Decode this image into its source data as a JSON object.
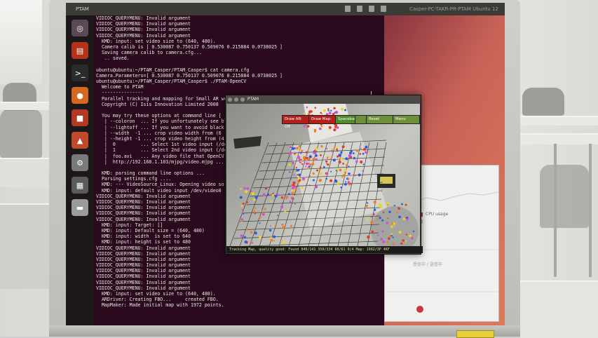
{
  "window_title": "PTAM",
  "topbar": {
    "title": "PTAM",
    "clock": "Casper-PC-TAKR-PR-PTAM Ubuntu 12"
  },
  "launcher": [
    {
      "name": "ubuntu-logo-icon",
      "glyph": "◎",
      "color": "#5a4a56"
    },
    {
      "name": "files-icon",
      "glyph": "▤",
      "color": "#b2321c"
    },
    {
      "name": "terminal-icon",
      "glyph": ">_",
      "color": "#2b2b2b"
    },
    {
      "name": "firefox-icon",
      "glyph": "●",
      "color": "#d2691e"
    },
    {
      "name": "office-icon",
      "glyph": "■",
      "color": "#b23a25"
    },
    {
      "name": "software-center-icon",
      "glyph": "▲",
      "color": "#c04a2c"
    },
    {
      "name": "settings-icon",
      "glyph": "⚙",
      "color": "#7a7a7a"
    },
    {
      "name": "workspace-icon",
      "glyph": "▦",
      "color": "#5b5b5b"
    },
    {
      "name": "trash-icon",
      "glyph": "▬",
      "color": "#9a9a9a"
    }
  ],
  "terminal": {
    "lines": [
      "VIDIOC_QUERYMENU: Invalid argument",
      "VIDIOC_QUERYMENU: Invalid argument",
      "VIDIOC_QUERYMENU: Invalid argument",
      "VIDIOC_QUERYMENU: Invalid argument",
      "  KMD: input: set video size to (640, 480).",
      "  Camera calib is [ 0.530087 0.750137 0.509076 0.215884 0.0738025 ]",
      "  Saving camera calib to camera.cfg...",
      "   .. saved.",
      "",
      "ubuntu@ubuntu:~/PTAM_Casper/PTAM_Casper$ cat camera.cfg",
      "Camera.Parameters=[ 0.530087 0.750137 0.509076 0.215884 0.0738025 ]",
      "ubuntu@ubuntu:~/PTAM_Casper/PTAM_Casper$ ./PTAM-OpenCV",
      "  Welcome to PTAM",
      "  ---------------",
      "  Parallel tracking and mapping for Small AR wo",
      "  Copyright (C) Isis Innovation Limited 2008",
      "",
      "  You may try these options at command line [",
      "   | --coloron  ... If you unfortunately see bl",
      "   | --lightoff ... If you want to avoid black",
      "   | --width  -1 ... crop video width from (6",
      "   | --height -1 ... crop video height from (4",
      "   |  0         ... Select 1st video input (/de",
      "   |  1         ... Select 2nd video input (/de",
      "   |  foo.avi   ... Any video file that OpenCV",
      "   |  http://192.168.1.103/mjpg/video.mjpg ...",
      "",
      "  KMD: parsing command line options ...",
      "  Parsing settings.cfg ....",
      "  KMD: --- VideoSource_Linux: Opening video so",
      "  KMD: input: default video input /dev/video0",
      "VIDIOC_QUERYMENU: Invalid argument",
      "VIDIOC_QUERYMENU: Invalid argument",
      "VIDIOC_QUERYMENU: Invalid argument",
      "VIDIOC_QUERYMENU: Invalid argument",
      "VIDIOC_QUERYMENU: Invalid argument",
      "  KMD: input: Target: []",
      "  KMD: input: Default size = (640, 480)",
      "  KMD: input: width  is set to 640",
      "  KMD: input: height is set to 480",
      "VIDIOC_QUERYMENU: Invalid argument",
      "VIDIOC_QUERYMENU: Invalid argument",
      "VIDIOC_QUERYMENU: Invalid argument",
      "VIDIOC_QUERYMENU: Invalid argument",
      "VIDIOC_QUERYMENU: Invalid argument",
      "VIDIOC_QUERYMENU: Invalid argument",
      "VIDIOC_QUERYMENU: Invalid argument",
      "VIDIOC_QUERYMENU: Invalid argument",
      "  KMD: input: set video size to (640, 480).",
      "  ARDriver: Creating FBO...     created FBO.",
      "  MapMaker: Made initial map with 1972 points."
    ]
  },
  "ptam": {
    "title": "PTAM",
    "menu": [
      {
        "label": "Draw AR: Off",
        "color": "#b3201c"
      },
      {
        "label": "Draw Map: Off",
        "color": "#b3201c"
      },
      {
        "label": "Spacebar",
        "color": "#4f8a2b"
      },
      {
        "label": "",
        "color": "#6e8f3a"
      },
      {
        "label": "Reset",
        "color": "#6e8f3a"
      },
      {
        "label": "Menu",
        "color": "#6e8f3a"
      }
    ],
    "status": "Tracking Map, quality good: Found 840/141 350/334 60/61 0/4 Map: 1992/3P 4KF"
  },
  "right_panel": {
    "legend": [
      {
        "label": "CPU usage",
        "color": "#c23a3a"
      },
      {
        "label": "",
        "color": "#bdbdbd"
      }
    ],
    "caption": "受信中 / 送信中"
  }
}
